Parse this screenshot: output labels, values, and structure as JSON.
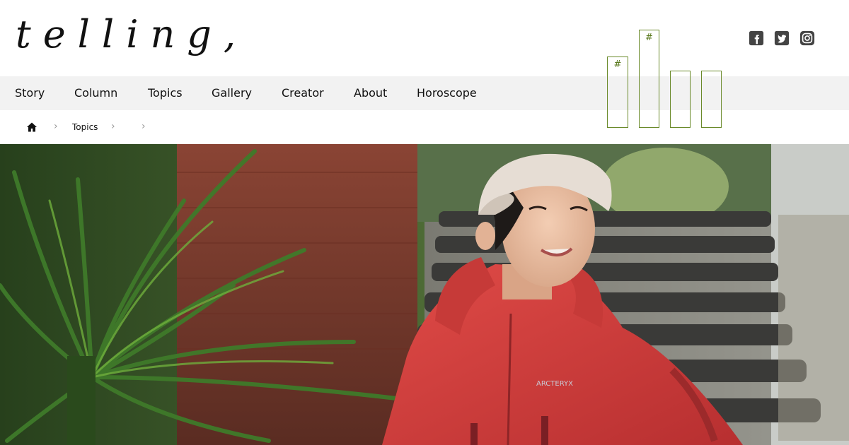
{
  "header": {
    "logo_text": "telling,",
    "social": [
      {
        "icon": "facebook-icon"
      },
      {
        "icon": "twitter-icon"
      },
      {
        "icon": "instagram-icon"
      }
    ],
    "hashtag_tiles": [
      "#",
      "#",
      "#",
      "#"
    ]
  },
  "nav": {
    "items": [
      "Story",
      "Column",
      "Topics",
      "Gallery",
      "Creator",
      "About",
      "Horoscope"
    ]
  },
  "breadcrumb": {
    "home_icon": "home-icon",
    "current": "Topics",
    "separator": "›"
  },
  "hero": {
    "jacket_logo": "ARCTERYX",
    "colors": {
      "jacket": "#d8403e",
      "cap": "#e6ddd4",
      "brick": "#7a3b2d",
      "foliage": "#3f6b2a",
      "stairs": "#3a3a38",
      "tag_border": "#6a8a2a"
    }
  }
}
